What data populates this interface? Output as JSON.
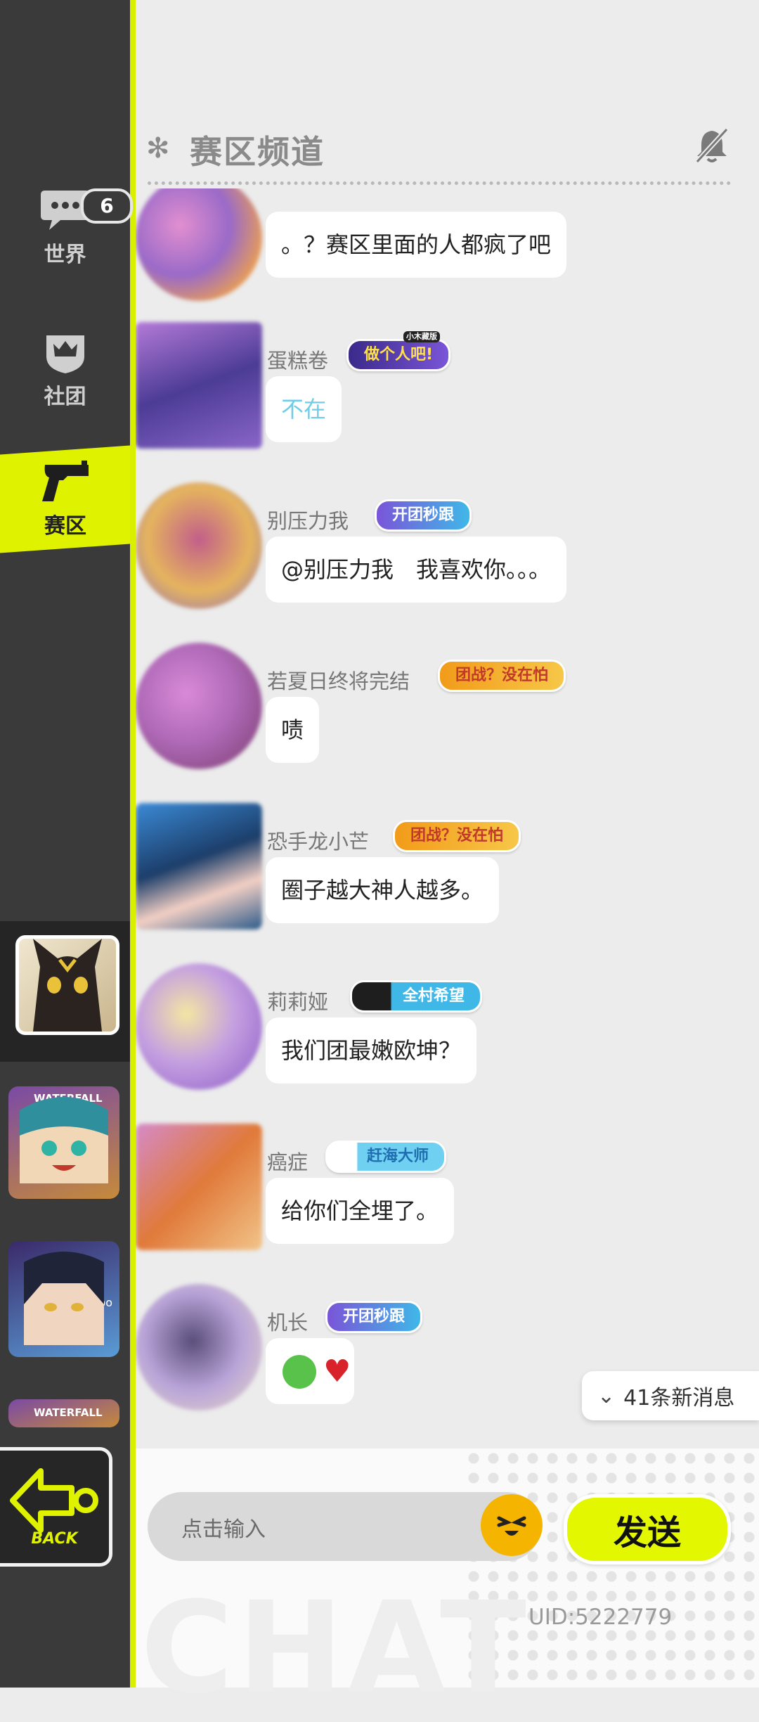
{
  "sidebar": {
    "items": [
      {
        "label": "世界",
        "badge": "6"
      },
      {
        "label": "社团"
      },
      {
        "label": "赛区"
      }
    ],
    "back_label": "BACK",
    "avatar_labels": [
      "WATERFALL",
      "oppo",
      "WATERFALL"
    ]
  },
  "header": {
    "title": "赛区频道"
  },
  "messages": [
    {
      "name": "",
      "text": "。？赛区里面的人都疯了吧",
      "tag": ""
    },
    {
      "name": "蛋糕卷",
      "text": "不在",
      "tag": "做个人吧!",
      "tag_small": "小木藏版"
    },
    {
      "name": "别压力我",
      "text": "@别压力我　我喜欢你。。。",
      "tag": "开团秒跟"
    },
    {
      "name": "若夏日终将完结",
      "text": "啧",
      "tag": "团战？没在怕"
    },
    {
      "name": "恐手龙小芒",
      "text": "圈子越大神人越多。",
      "tag": "团战？没在怕"
    },
    {
      "name": "莉莉娅",
      "text": "我们团最嫩欧坤？",
      "tag": "全村希望"
    },
    {
      "name": "癌症",
      "text": "给你们全埋了。",
      "tag": "赶海大师"
    },
    {
      "name": "机长",
      "text": "",
      "tag": "开团秒跟"
    }
  ],
  "new_messages": "41条新消息",
  "input": {
    "placeholder": "点击输入",
    "send_label": "发送"
  },
  "uid": "UID:5222779",
  "colors": {
    "accent": "#DFF200",
    "sidebar_bg": "#3A3A3A",
    "tag_purple": "#5B3FC4",
    "tag_cyan": "#3FB8E8",
    "tag_orange": "#F29B1A"
  }
}
